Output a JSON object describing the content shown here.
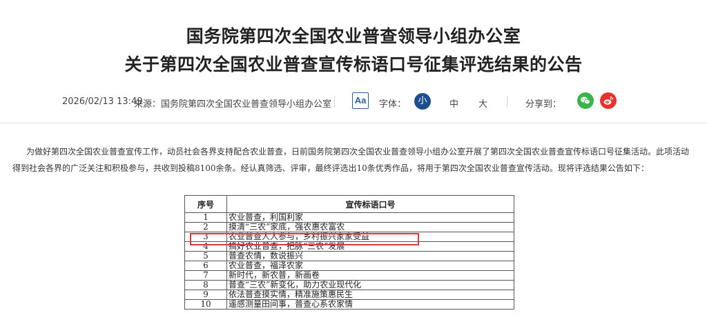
{
  "title": {
    "line1": "国务院第四次全国农业普查领导小组办公室",
    "line2": "关于第四次全国农业普查宣传标语口号征集评选结果的公告"
  },
  "meta": {
    "date": "2026/02/13 13:49",
    "source": "来源：国务院第四次全国农业普查领导小组办公室",
    "aa_label": "Aa",
    "font_label": "字体：",
    "font_small": "小",
    "font_medium": "中",
    "font_large": "大",
    "share_label": "分享到："
  },
  "icons": {
    "wechat": "wechat-icon",
    "weibo": "weibo-icon",
    "wechat_color": "#39b54a",
    "weibo_color": "#e6312d",
    "accent": "#1d4f8c"
  },
  "body": {
    "paragraph": "为做好第四次全国农业普查宣传工作，动员社会各界支持配合农业普查，日前国务院第四次全国农业普查领导小组办公室开展了第四次全国农业普查宣传标语口号征集活动。此项活动得到社会各界的广泛关注和积极参与，共收到投稿8100余条。经认真筛选、评审，最终评选出10条优秀作品，将用于第四次全国农业普查宣传活动。现将评选结果公告如下："
  },
  "table": {
    "headers": [
      "序号",
      "宣传标语口号"
    ],
    "rows": [
      [
        "1",
        "农业普查，利国利家"
      ],
      [
        "2",
        "摸清“三农”家底，强农惠农富农"
      ],
      [
        "3",
        "农业普查人人参与，乡村振兴家家受益"
      ],
      [
        "4",
        "搞好农业普查，把脉“三农”发展"
      ],
      [
        "5",
        "普查农情，数说振兴"
      ],
      [
        "6",
        "农业普查，福泽农家"
      ],
      [
        "7",
        "新时代，新农普，新画卷"
      ],
      [
        "8",
        "普查“三农”新变化，助力农业现代化"
      ],
      [
        "9",
        "依法普查摸实情，精准施策惠民生"
      ],
      [
        "10",
        "遥感测量田间事，普查心系农家情"
      ]
    ]
  }
}
